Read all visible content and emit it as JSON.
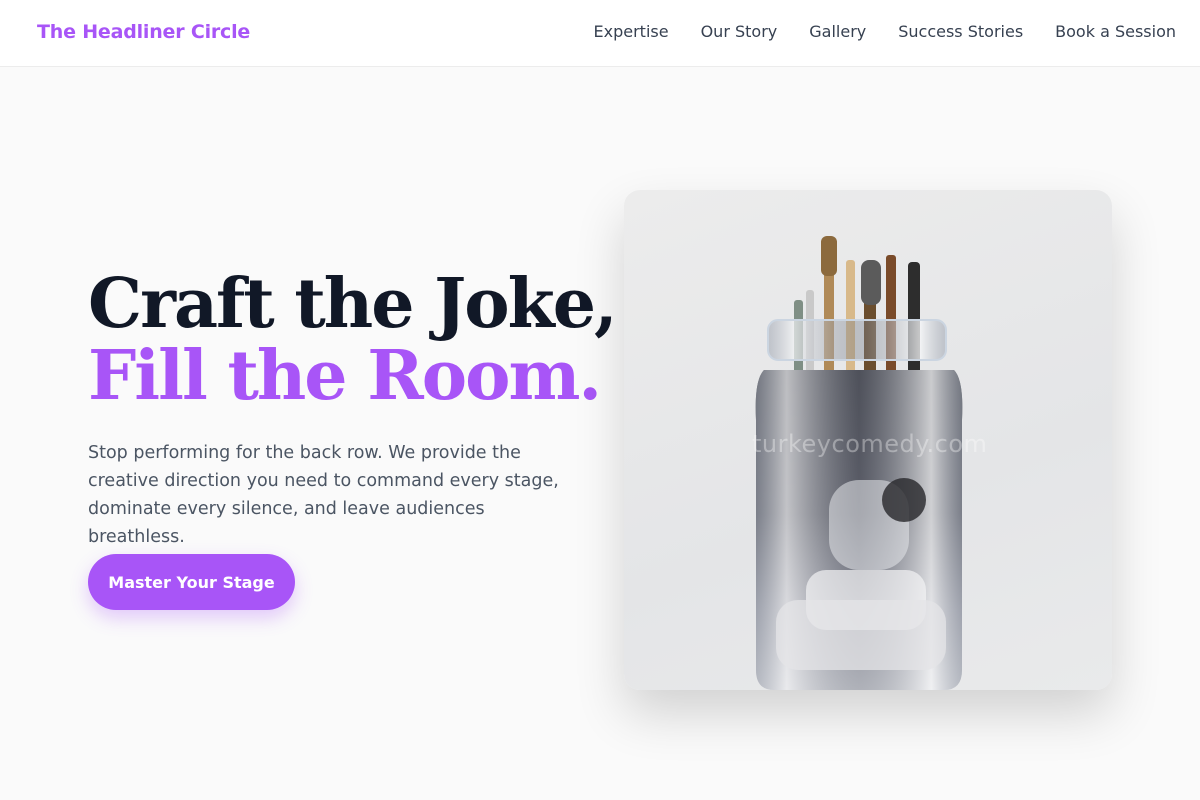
{
  "nav": {
    "brand": "The Headliner Circle",
    "links": [
      {
        "label": "Expertise"
      },
      {
        "label": "Our Story"
      },
      {
        "label": "Gallery"
      },
      {
        "label": "Success Stories"
      },
      {
        "label": "Book a Session"
      }
    ]
  },
  "hero": {
    "title_line1": "Craft the Joke,",
    "title_line2": "Fill the Room.",
    "description": "Stop performing for the back row. We provide the creative direction you need to command every stage, dominate every silence, and leave audiences breathless.",
    "cta_label": "Master Your Stage",
    "image": {
      "watermark": "turkeycomedy.com"
    }
  },
  "colors": {
    "accent": "#a855f7",
    "heading": "#111827",
    "body_text": "#4b5563",
    "background": "#fafafa"
  }
}
